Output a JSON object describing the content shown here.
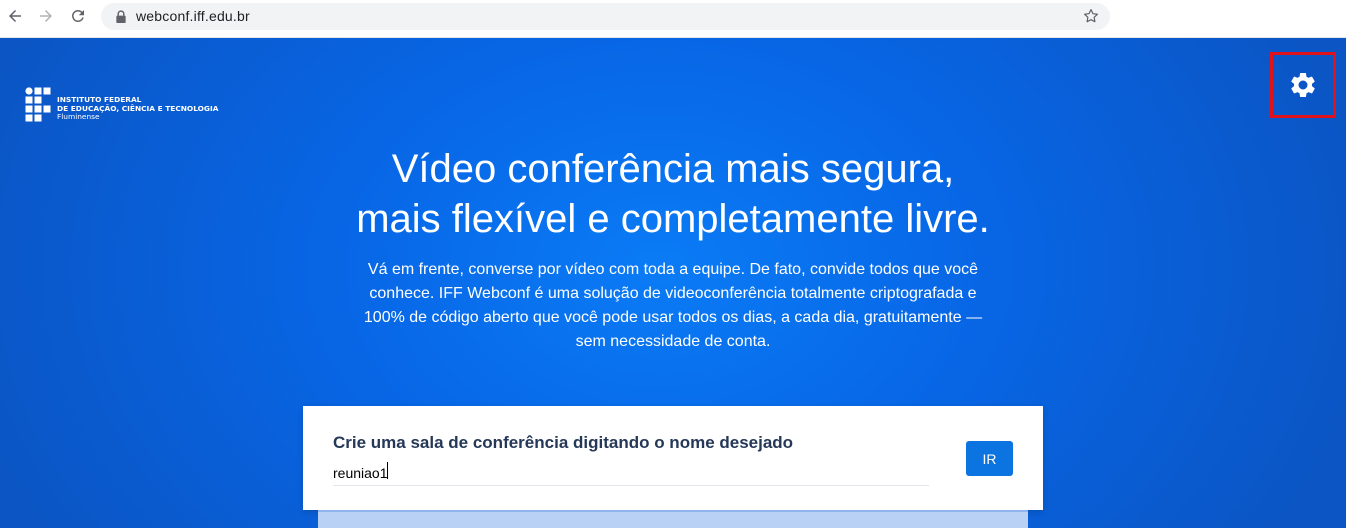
{
  "browser": {
    "url": "webconf.iff.edu.br",
    "icons": {
      "back": "arrow-left-icon",
      "forward": "arrow-right-icon",
      "reload": "reload-icon",
      "lock": "lock-icon",
      "bookmark": "star-icon"
    }
  },
  "logo": {
    "line1": "INSTITUTO FEDERAL",
    "line2": "DE EDUCAÇÃO, CIÊNCIA E TECNOLOGIA",
    "line3": "Fluminense"
  },
  "settings": {
    "icon": "gear-icon",
    "highlight_color": "#e0121c"
  },
  "hero": {
    "headline_line1": "Vídeo conferência mais segura,",
    "headline_line2": "mais flexível e completamente livre.",
    "description": "Vá em frente, converse por vídeo com toda a equipe. De fato, convide todos que você conhece. IFF Webconf é uma solução de videoconferência totalmente criptografada e 100% de código aberto que você pode usar todos os dias, a cada dia, gratuitamente — sem necessidade de conta."
  },
  "room_form": {
    "title": "Crie uma sala de conferência digitando o nome desejado",
    "room_value": "reuniao1",
    "button_label": "IR"
  },
  "colors": {
    "hero_bg": "#0866e5",
    "button_bg": "#0c74e0",
    "title_text": "#253858"
  }
}
